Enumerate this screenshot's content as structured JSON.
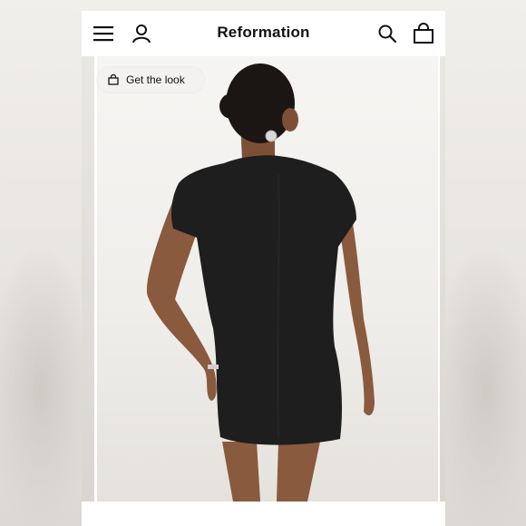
{
  "header": {
    "brand": "Reformation",
    "menu_icon": "hamburger-menu-icon",
    "account_icon": "user-icon",
    "search_icon": "search-icon",
    "bag_icon": "shopping-bag-icon"
  },
  "product": {
    "get_the_look_label": "Get the look",
    "get_the_look_icon": "shopping-bag-icon",
    "image_alt": "Model wearing black short-sleeve mini dress, back view"
  },
  "colors": {
    "dress": "#1e1e1f",
    "skin": "#8a5a3e",
    "hair": "#1b1513"
  }
}
